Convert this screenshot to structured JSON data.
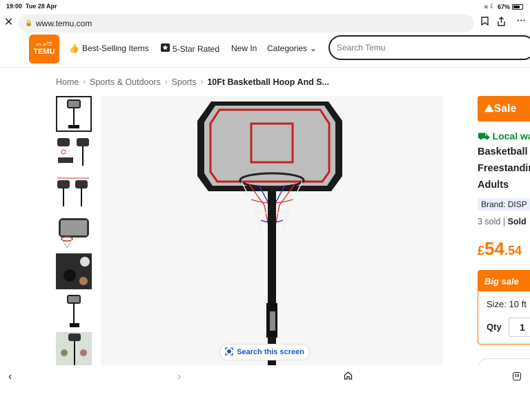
{
  "status_bar": {
    "time": "19:00",
    "date": "Tue 28 Apr",
    "battery": "67%"
  },
  "browser": {
    "url": "www.temu.com",
    "close_icon": "✕"
  },
  "header": {
    "logo_glyphs": "ᔕᓄᗢ",
    "logo_text": "TEMU",
    "nav": [
      {
        "label": "Best-Selling Items",
        "icon": "thumbs-up-icon"
      },
      {
        "label": "5-Star Rated",
        "icon": "star-badge-icon"
      },
      {
        "label": "New In"
      },
      {
        "label": "Categories"
      }
    ],
    "search_placeholder": "Search Temu"
  },
  "breadcrumb": [
    "Home",
    "Sports & Outdoors",
    "Sports",
    "10Ft Basketball Hoop And S..."
  ],
  "lens_button": "Search this screen",
  "product": {
    "sale_banner": "Sale",
    "local_warehouse": "Local wa",
    "title_lines": [
      "Basketball",
      "Freestandin",
      "Adults"
    ],
    "brand": "Brand: DISP",
    "sold_count": "3 sold",
    "sold_by": "Sold",
    "price": {
      "currency": "£",
      "integer": "54",
      "decimal": ".54"
    },
    "big_sale": "Big sale",
    "size": "Size: 10 ft",
    "qty_label": "Qty",
    "qty_value": "1"
  },
  "colors": {
    "accent": "#fb7701",
    "local_green": "#0a8a2e",
    "link_blue": "#1a56c4"
  },
  "bottom_bar": {
    "tabs_count": "19"
  }
}
